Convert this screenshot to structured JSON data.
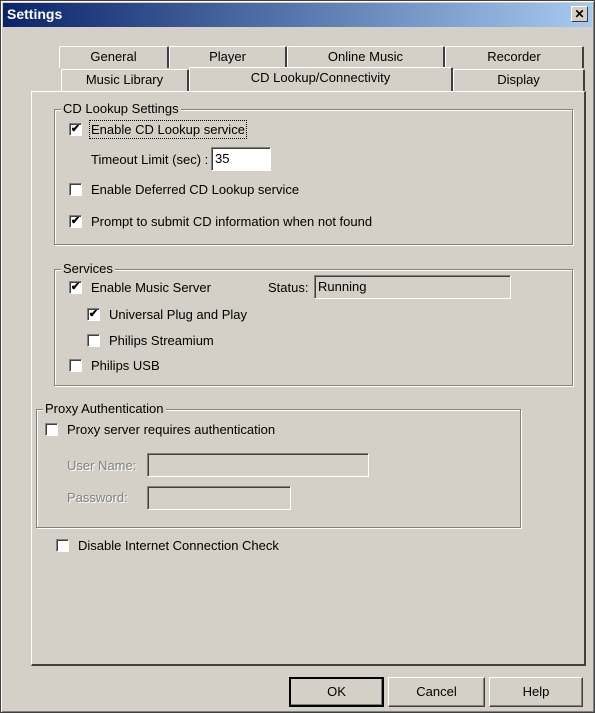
{
  "window": {
    "title": "Settings",
    "close_glyph": "✕"
  },
  "tabs_row1": [
    {
      "label": "General"
    },
    {
      "label": "Player"
    },
    {
      "label": "Online Music"
    },
    {
      "label": "Recorder"
    }
  ],
  "tabs_row2": [
    {
      "label": "Music Library"
    },
    {
      "label": "CD Lookup/Connectivity"
    },
    {
      "label": "Display"
    }
  ],
  "cd_lookup": {
    "legend": "CD Lookup Settings",
    "enable_cd_lookup": {
      "label": "Enable CD Lookup service",
      "checked": true
    },
    "timeout_label": "Timeout Limit (sec) :",
    "timeout_value": "35",
    "deferred": {
      "label": "Enable Deferred CD Lookup service",
      "checked": false
    },
    "prompt_submit": {
      "label": "Prompt to submit CD information when not found",
      "checked": true
    }
  },
  "services": {
    "legend": "Services",
    "music_server": {
      "label": "Enable Music Server",
      "checked": true
    },
    "status_label": "Status:",
    "status_value": "Running",
    "upnp": {
      "label": "Universal Plug and Play",
      "checked": true
    },
    "streamium": {
      "label": "Philips Streamium",
      "checked": false
    },
    "philips_usb": {
      "label": "Philips USB",
      "checked": false
    }
  },
  "proxy": {
    "legend": "Proxy Authentication",
    "requires_auth": {
      "label": "Proxy server requires authentication",
      "checked": false
    },
    "username_label": "User Name:",
    "username_value": "",
    "password_label": "Password:",
    "password_value": ""
  },
  "disable_check": {
    "label": "Disable Internet Connection Check",
    "checked": false
  },
  "buttons": {
    "ok": "OK",
    "cancel": "Cancel",
    "help": "Help"
  },
  "check_glyph": "✔"
}
